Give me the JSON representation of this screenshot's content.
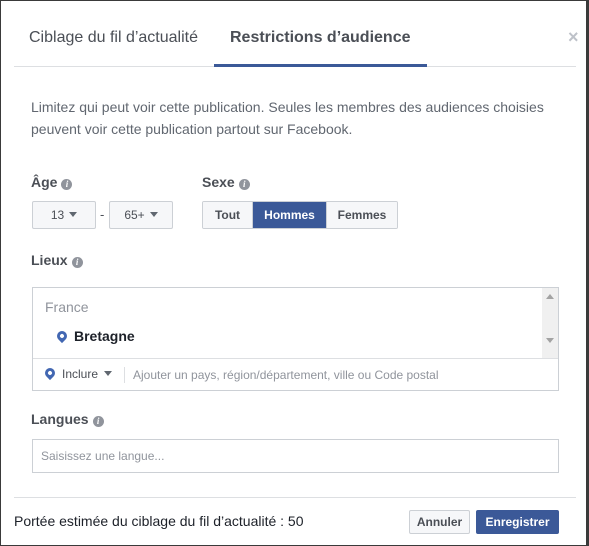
{
  "tabs": [
    {
      "label": "Ciblage du fil d’actualité",
      "active": false
    },
    {
      "label": "Restrictions d’audience",
      "active": true
    }
  ],
  "close_icon": "close-icon",
  "description": "Limitez qui peut voir cette publication. Seules les membres des audiences choisies peuvent voir cette publication partout sur Facebook.",
  "age": {
    "label": "Âge",
    "info_icon": "i",
    "min": "13",
    "separator": "-",
    "max": "65+"
  },
  "gender": {
    "label": "Sexe",
    "info_icon": "i",
    "options": [
      "Tout",
      "Hommes",
      "Femmes"
    ],
    "selected": "Hommes"
  },
  "locations": {
    "label": "Lieux",
    "info_icon": "i",
    "country": "France",
    "items": [
      "Bretagne"
    ],
    "mode": "Inclure",
    "placeholder": "Ajouter un pays, région/département, ville ou Code postal"
  },
  "languages": {
    "label": "Langues",
    "info_icon": "i",
    "placeholder": "Saisissez une langue..."
  },
  "footer": {
    "reach": "Portée estimée du ciblage du fil d’actualité : 50",
    "cancel_label": "Annuler",
    "save_label": "Enregistrer"
  },
  "colors": {
    "accent": "#3b5998",
    "text": "#4b4f56",
    "border": "#ccd0d5"
  }
}
